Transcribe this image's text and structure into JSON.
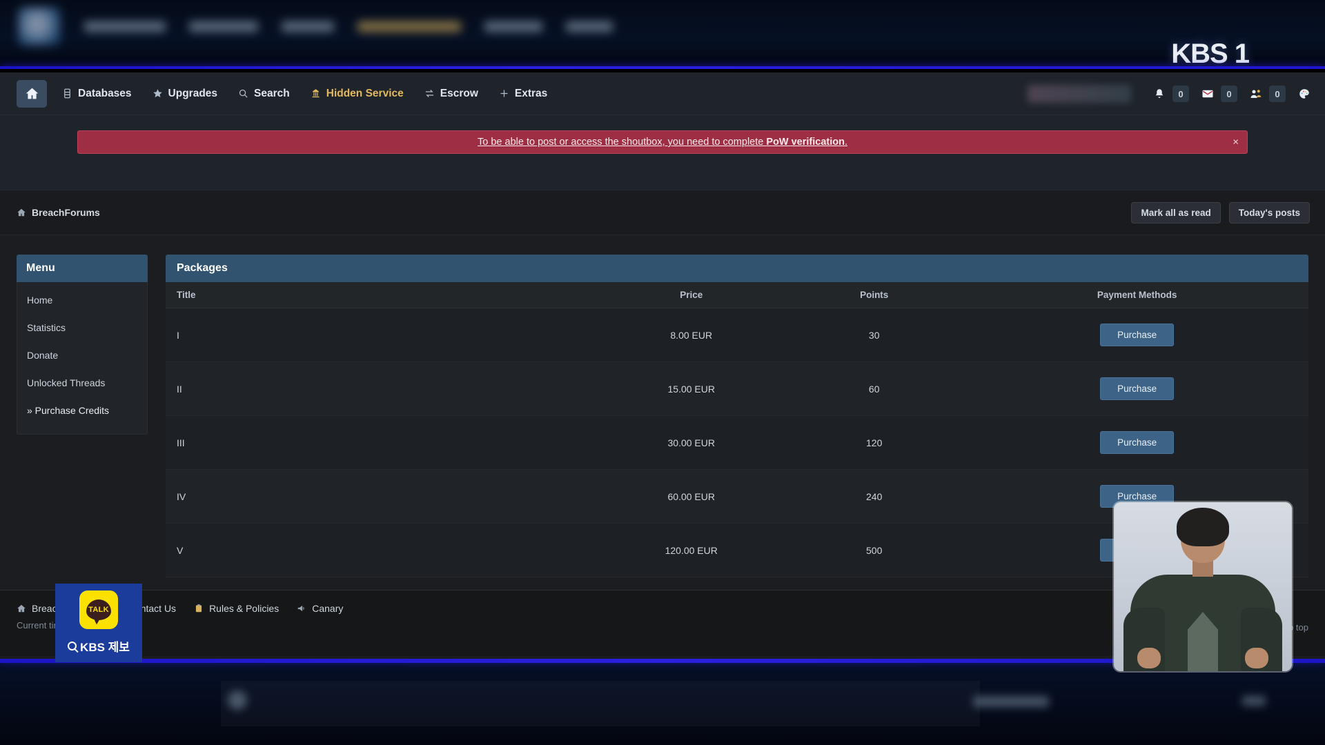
{
  "broadcast": {
    "channel_logo": "KBS 1",
    "kakao": {
      "badge_text": "TALK",
      "label": "KBS 제보",
      "icon": "search-icon"
    }
  },
  "nav": {
    "home_icon": "home-icon",
    "links": [
      {
        "label": "Databases",
        "icon": "database-icon",
        "highlight": false
      },
      {
        "label": "Upgrades",
        "icon": "star-icon",
        "highlight": false
      },
      {
        "label": "Search",
        "icon": "search-icon",
        "highlight": false
      },
      {
        "label": "Hidden Service",
        "icon": "onion-icon",
        "highlight": true
      },
      {
        "label": "Escrow",
        "icon": "exchange-icon",
        "highlight": false
      },
      {
        "label": "Extras",
        "icon": "plus-icon",
        "highlight": false
      }
    ],
    "right": {
      "alerts": {
        "icon": "bell-icon",
        "count": "0"
      },
      "messages": {
        "icon": "envelope-icon",
        "count": "0"
      },
      "friend_requests": {
        "icon": "user-friends-icon",
        "count": "0"
      },
      "theme": {
        "icon": "palette-icon"
      }
    }
  },
  "alert": {
    "text": "To be able to post or access the shoutbox, you need to complete ",
    "bold_text": "PoW verification",
    "text_end": ".",
    "close_label": "×",
    "color": "#9e2e43"
  },
  "breadcrumb": {
    "home_icon": "home-icon",
    "root": "BreachForums",
    "mark_read": "Mark all as read",
    "todays_posts": "Today's posts"
  },
  "sidebar": {
    "title": "Menu",
    "items": [
      {
        "label": "Home",
        "current": false
      },
      {
        "label": "Statistics",
        "current": false
      },
      {
        "label": "Donate",
        "current": false
      },
      {
        "label": "Unlocked Threads",
        "current": false
      },
      {
        "label": "» Purchase Credits",
        "current": true
      }
    ]
  },
  "packages": {
    "title": "Packages",
    "columns": [
      "Title",
      "Price",
      "Points",
      "Payment Methods"
    ],
    "purchase_label": "Purchase",
    "rows": [
      {
        "title": "I",
        "price": "8.00 EUR",
        "points": "30"
      },
      {
        "title": "II",
        "price": "15.00 EUR",
        "points": "60"
      },
      {
        "title": "III",
        "price": "30.00 EUR",
        "points": "120"
      },
      {
        "title": "IV",
        "price": "60.00 EUR",
        "points": "240"
      },
      {
        "title": "V",
        "price": "120.00 EUR",
        "points": "500"
      }
    ]
  },
  "footer": {
    "links": [
      {
        "label": "BreachForums",
        "icon": "home-icon"
      },
      {
        "label": "Contact Us",
        "icon": "envelope-icon"
      },
      {
        "label": "Rules & Policies",
        "icon": "clipboard-icon"
      },
      {
        "label": "Canary",
        "icon": "bullhorn-icon"
      }
    ],
    "current_time": "Current time: 11:47 AM",
    "back_to_top": "Go to top"
  },
  "colors": {
    "accent_panel": "#31536f",
    "alert_red": "#9e2e43",
    "button_blue": "#3d6487",
    "gold": "#e3b95e"
  }
}
